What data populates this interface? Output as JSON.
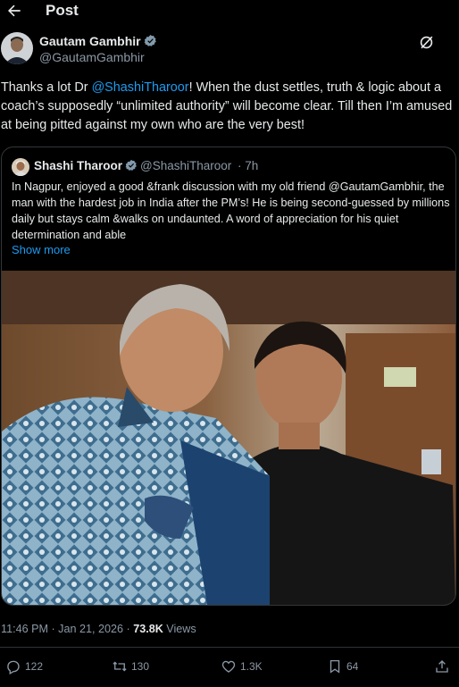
{
  "header": {
    "title": "Post"
  },
  "author": {
    "name": "Gautam Gambhir",
    "handle": "@GautamGambhir"
  },
  "post": {
    "text_1": "Thanks a lot Dr ",
    "mention": "@ShashiTharoor",
    "text_2": "! When the dust settles, truth & logic about a coach’s supposedly “unlimited authority” will become clear. Till then I’m amused at being pitted against my own who are the very best!"
  },
  "quote": {
    "name": "Shashi Tharoor",
    "handle": "@ShashiTharoor",
    "time": "· 7h",
    "text": "In Nagpur, enjoyed a good &frank discussion with my old friend @GautamGambhir, the man with the hardest job in India after the PM’s! He is being second-guessed by millions daily but stays calm &walks on undaunted. A word of appreciation for his quiet determination and able",
    "show_more": "Show more"
  },
  "meta": {
    "time": "11:46 PM · Jan 21, 2026 · ",
    "views": "73.8K",
    "views_label": " Views"
  },
  "actions": {
    "replies": "122",
    "reposts": "130",
    "likes": "1.3K",
    "bookmarks": "64"
  },
  "colors": {
    "accent": "#1d9bf0",
    "background": "#000000",
    "muted": "#8b98a5"
  }
}
